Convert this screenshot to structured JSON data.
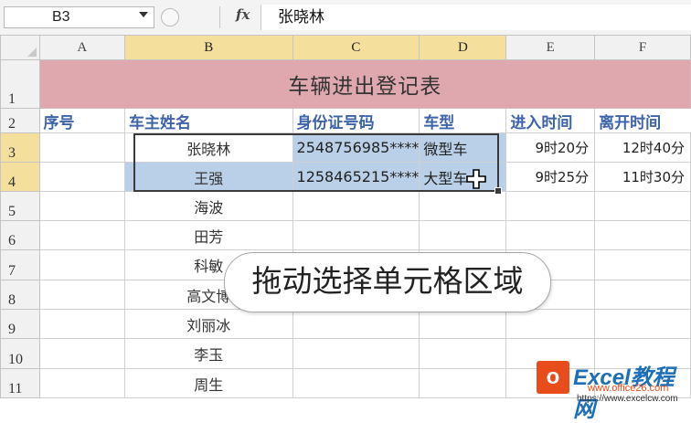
{
  "formula_bar": {
    "name_box": "B3",
    "fx": "fx",
    "formula": "张晓林"
  },
  "columns": [
    "A",
    "B",
    "C",
    "D",
    "E",
    "F"
  ],
  "rows": [
    "1",
    "2",
    "3",
    "4",
    "5",
    "6",
    "7",
    "8",
    "9",
    "10",
    "11"
  ],
  "sheet": {
    "title": "车辆进出登记表",
    "headers": {
      "a": "序号",
      "b": "车主姓名",
      "c": "身份证号码",
      "d": "车型",
      "e": "进入时间",
      "f": "离开时间"
    },
    "r3": {
      "b": "张晓林",
      "c": "2548756985****",
      "d": "微型车",
      "e": "9时20分",
      "f": "12时40分"
    },
    "r4": {
      "b": "王强",
      "c": "1258465215****",
      "d": "大型车",
      "e": "9时25分",
      "f": "11时30分"
    },
    "names": {
      "r5": "海波",
      "r6": "田芳",
      "r7": "科敏",
      "r8": "高文博",
      "r9": "刘丽冰",
      "r10": "李玉",
      "r11": "周生"
    }
  },
  "tooltip": "拖动选择单元格区域",
  "watermark": {
    "box": "o",
    "title": "Excel教程网",
    "sub": "www.office26.com",
    "url": "https://www.excelcw.com"
  },
  "colors": {
    "title_fill": "#dea8ae",
    "header_text": "#3d63a8",
    "selection_fill": "#b9d0e8",
    "header_highlight": "#f5df9d"
  }
}
